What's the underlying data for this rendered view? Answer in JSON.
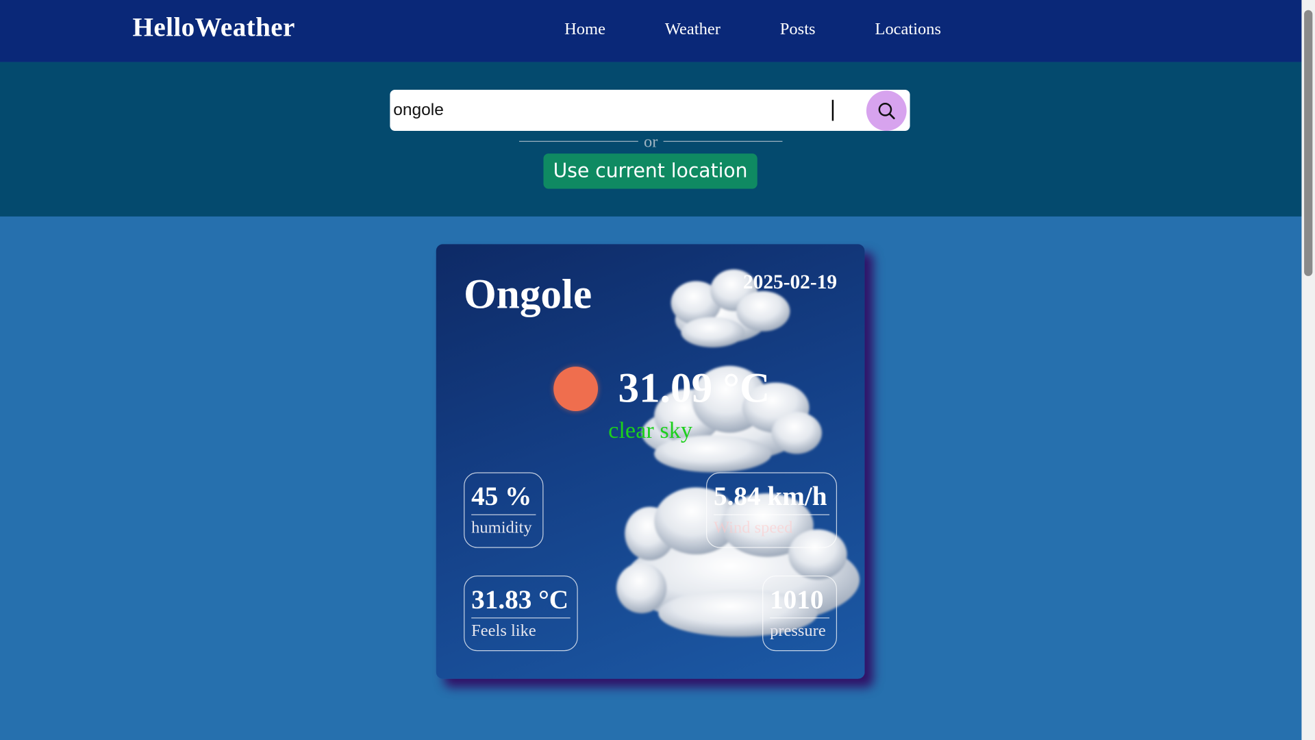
{
  "navbar": {
    "brand": "HelloWeather",
    "links": [
      "Home",
      "Weather",
      "Posts",
      "Locations"
    ]
  },
  "search": {
    "value": "ongole",
    "or_text": "or",
    "location_button": "Use current location",
    "search_icon": "search-icon"
  },
  "weather": {
    "city": "Ongole",
    "date": "2025-02-19",
    "temperature": "31.09 °C",
    "description": "clear sky",
    "condition_icon": "sun-icon",
    "stats": {
      "humidity": {
        "value": "45 %",
        "label": "humidity"
      },
      "wind": {
        "value": "5.84 km/h",
        "label": "Wind speed"
      },
      "feels_like": {
        "value": "31.83 °C",
        "label": "Feels like"
      },
      "pressure": {
        "value": "1010",
        "label": "pressure"
      }
    }
  },
  "colors": {
    "navbar_bg": "#0a2878",
    "search_band_bg": "#044a6e",
    "page_bg": "#2670ae",
    "search_button_bg": "#d7a3ee",
    "location_button_bg": "#0f8a62",
    "description_color": "#1cd01c",
    "sun_color": "#ef6e4e"
  }
}
